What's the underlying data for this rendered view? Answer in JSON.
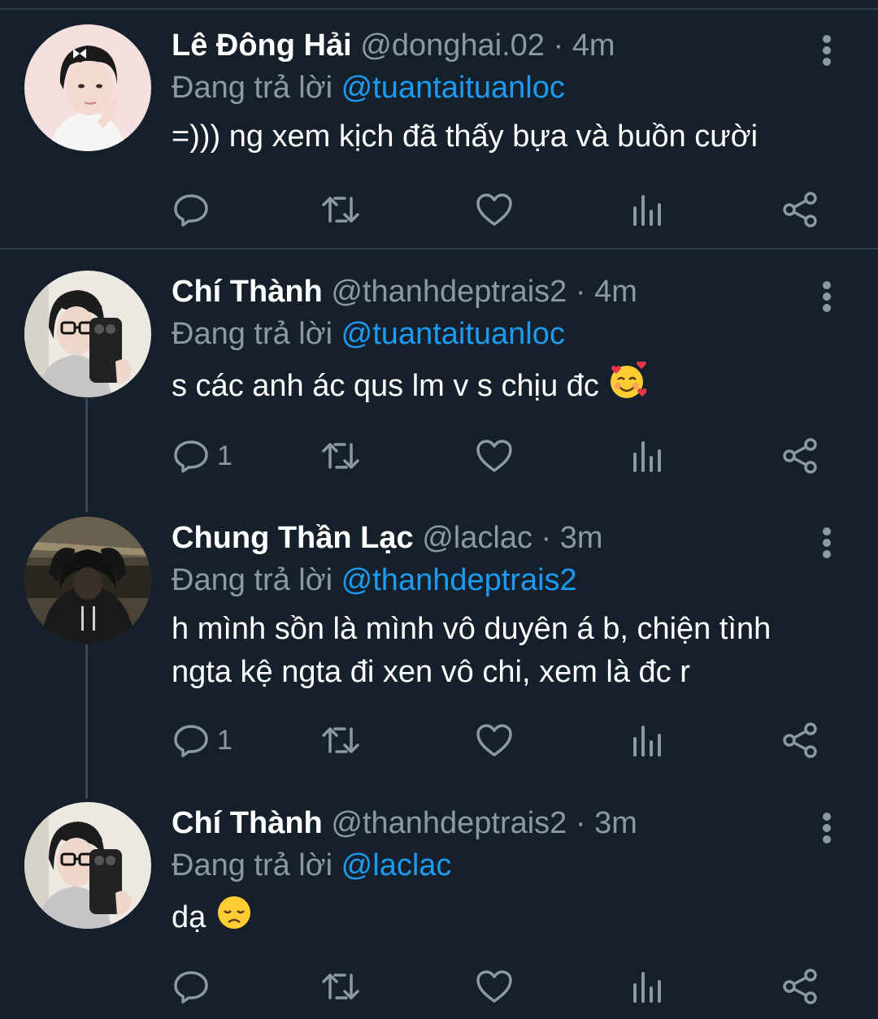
{
  "tweets": [
    {
      "name": "Lê Đông Hải",
      "handle": "@donghai.02",
      "time": "4m",
      "reply_prefix": "Đang trả lời",
      "reply_to": "@tuantaituanloc",
      "text": "=))) ng xem kịch đã thấy bựa và buồn cười",
      "reply_count": ""
    },
    {
      "name": "Chí Thành",
      "handle": "@thanhdeptrais2",
      "time": "4m",
      "reply_prefix": "Đang trả lời",
      "reply_to": "@tuantaituanloc",
      "text": "s các anh ác qus lm v s chịu đc",
      "emoji": "smiling-face-with-hearts",
      "reply_count": "1"
    },
    {
      "name": "Chung Thần Lạc",
      "handle": "@laclac",
      "time": "3m",
      "reply_prefix": "Đang trả lời",
      "reply_to": "@thanhdeptrais2",
      "text": "h mình sồn là mình vô duyên á b, chiện tình ngta kệ ngta đi xen vô chi, xem là đc r",
      "reply_count": "1"
    },
    {
      "name": "Chí Thành",
      "handle": "@thanhdeptrais2",
      "time": "3m",
      "reply_prefix": "Đang trả lời",
      "reply_to": "@laclac",
      "text": "dạ",
      "emoji": "disappointed-face",
      "reply_count": ""
    }
  ],
  "separator": "·",
  "colors": {
    "background": "#15202b",
    "text": "#ffffff",
    "muted": "#8b98a5",
    "mention": "#1d9bf0",
    "divider": "#2f3b47"
  }
}
